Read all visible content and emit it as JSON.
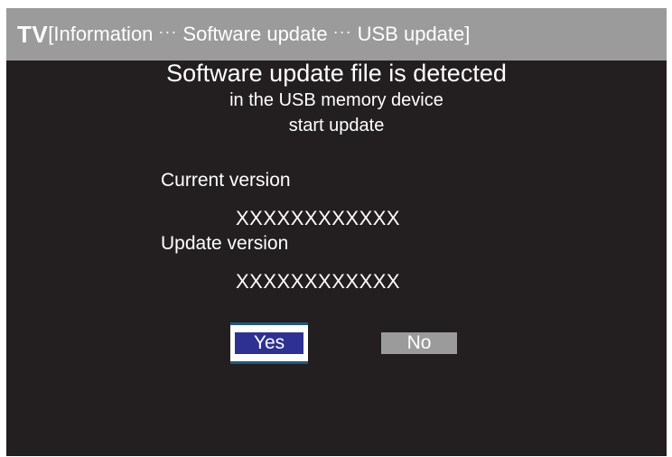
{
  "header": {
    "tv_label": "TV",
    "open_bracket": "[",
    "crumbs": [
      "Information",
      "Software update",
      "USB update"
    ],
    "separator": "···",
    "close_bracket": "]"
  },
  "message": {
    "line1": "Software update file is detected",
    "line2": "in the USB memory device",
    "line3": "start update"
  },
  "versions": {
    "current_label": "Current version",
    "current_value": "XXXXXXXXXXXX",
    "update_label": "Update version",
    "update_value": "XXXXXXXXXXXX"
  },
  "buttons": {
    "yes": "Yes",
    "no": "No"
  },
  "colors": {
    "screen_bg": "#231f20",
    "title_bar": "#9b9b9b",
    "focus_blue": "#2e3192",
    "text": "#ffffff"
  }
}
